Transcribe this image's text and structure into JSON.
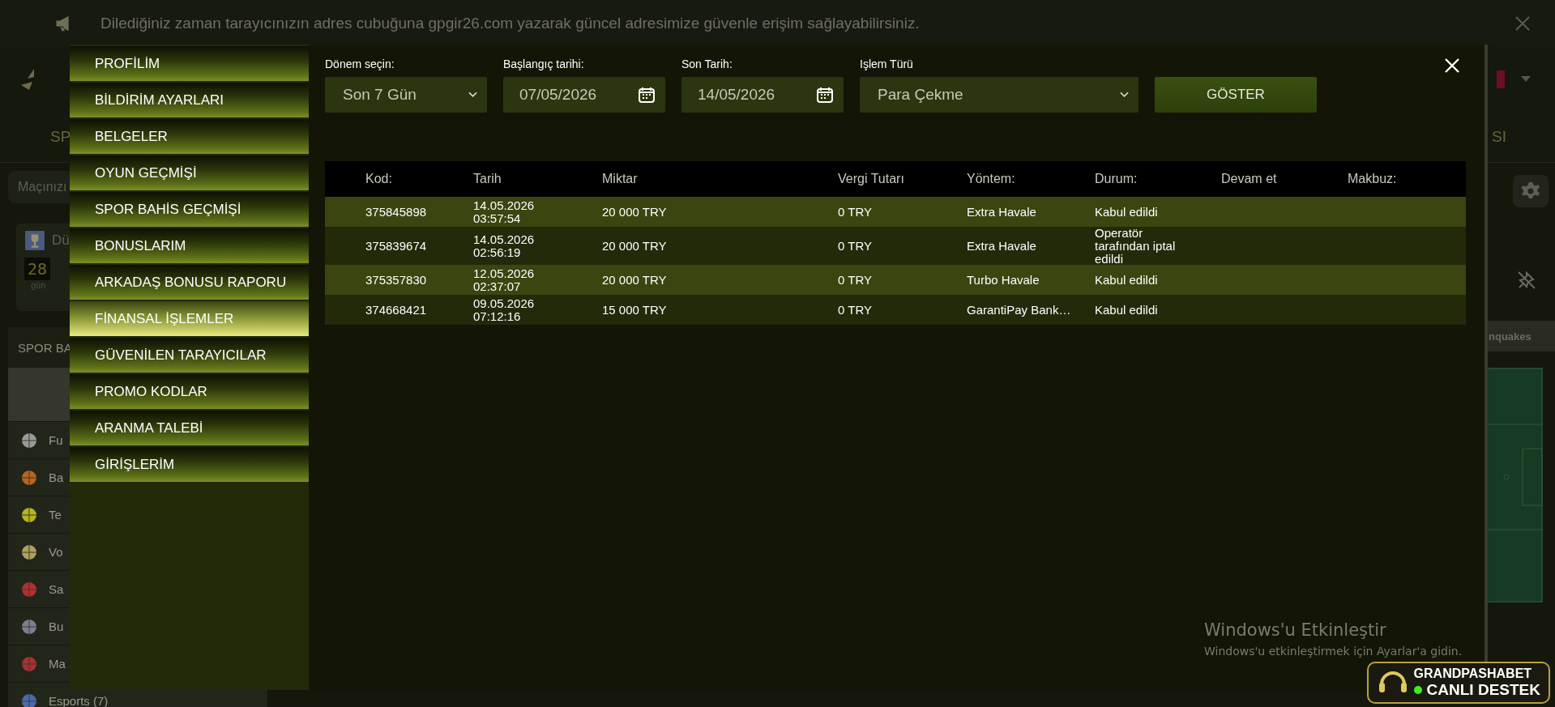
{
  "notice": {
    "text": "Dilediğiniz zaman tarayıcınızın adres cubuğuna gpgir26.com yazarak güncel adresimize güvenle erişim sağlayabilirsiniz."
  },
  "background_page": {
    "nav_left": "SP",
    "nav_right": "SI",
    "search": {
      "placeholder": "Maçınızı"
    },
    "event_card": {
      "title": "Dü",
      "countdown": "28",
      "unit": "gün"
    },
    "section_title": "SPOR BA",
    "sports": [
      {
        "label": "Fu",
        "kind": "football"
      },
      {
        "label": "Ba",
        "kind": "basketball"
      },
      {
        "label": "Te",
        "kind": "tennis"
      },
      {
        "label": "Vo",
        "kind": "volleyball"
      },
      {
        "label": "Sa",
        "kind": "racing"
      },
      {
        "label": "Bu",
        "kind": "hockey"
      },
      {
        "label": "Ma",
        "kind": "pingpong"
      },
      {
        "label": "Esports (7)",
        "kind": "esports"
      }
    ],
    "side_label": "nquakes"
  },
  "menu": [
    {
      "label": "PROFİLİM",
      "selected": false
    },
    {
      "label": "BİLDİRİM AYARLARI",
      "selected": false
    },
    {
      "label": "BELGELER",
      "selected": false
    },
    {
      "label": "OYUN GEÇMİŞİ",
      "selected": false
    },
    {
      "label": "SPOR BAHİS GEÇMİŞİ",
      "selected": false
    },
    {
      "label": "BONUSLARIM",
      "selected": false
    },
    {
      "label": "ARKADAŞ BONUSU RAPORU",
      "selected": false
    },
    {
      "label": "FİNANSAL İŞLEMLER",
      "selected": true
    },
    {
      "label": "GÜVENİLEN TARAYICILAR",
      "selected": false
    },
    {
      "label": "PROMO KODLAR",
      "selected": false
    },
    {
      "label": "ARANMA TALEBİ",
      "selected": false
    },
    {
      "label": "GİRİŞLERİM",
      "selected": false
    }
  ],
  "filters": [
    {
      "kind": "select",
      "label": "Dönem seçin:",
      "value": "Son 7 Gün"
    },
    {
      "kind": "date",
      "label": "Başlangıç tarihi:",
      "value": "07/05/2026"
    },
    {
      "kind": "date",
      "label": "Son Tarih:",
      "value": "14/05/2026"
    },
    {
      "kind": "select",
      "label": "Işlem Türü",
      "value": "Para Çekme"
    }
  ],
  "show_button": "GÖSTER",
  "table": {
    "columns": [
      "Kod:",
      "Tarih",
      "Miktar",
      "Vergi Tutarı",
      "Yöntem:",
      "Durum:",
      "Devam et",
      "Makbuz:"
    ],
    "rows": [
      {
        "code": "375845898",
        "date": "14.05.2026 03:57:54",
        "amount": "20 000 TRY",
        "tax": "0 TRY",
        "method": "Extra Havale",
        "status": "Kabul edildi"
      },
      {
        "code": "375839674",
        "date": "14.05.2026 02:56:19",
        "amount": "20 000 TRY",
        "tax": "0 TRY",
        "method": "Extra Havale",
        "status": "Operatör tarafından iptal edildi"
      },
      {
        "code": "375357830",
        "date": "12.05.2026 02:37:07",
        "amount": "20 000 TRY",
        "tax": "0 TRY",
        "method": "Turbo Havale",
        "status": "Kabul edildi"
      },
      {
        "code": "374668421",
        "date": "09.05.2026 07:12:16",
        "amount": "15 000 TRY",
        "tax": "0 TRY",
        "method": "GarantiPay Bank…",
        "status": "Kabul edildi"
      }
    ]
  },
  "windows_notice": {
    "title": "Windows'u Etkinleştir",
    "text": "Windows'u etkinleştirmek için Ayarlar'a gidin."
  },
  "support_widget": {
    "brand": "GRANDPASHABET",
    "label": "CANLI DESTEK",
    "online": true
  }
}
